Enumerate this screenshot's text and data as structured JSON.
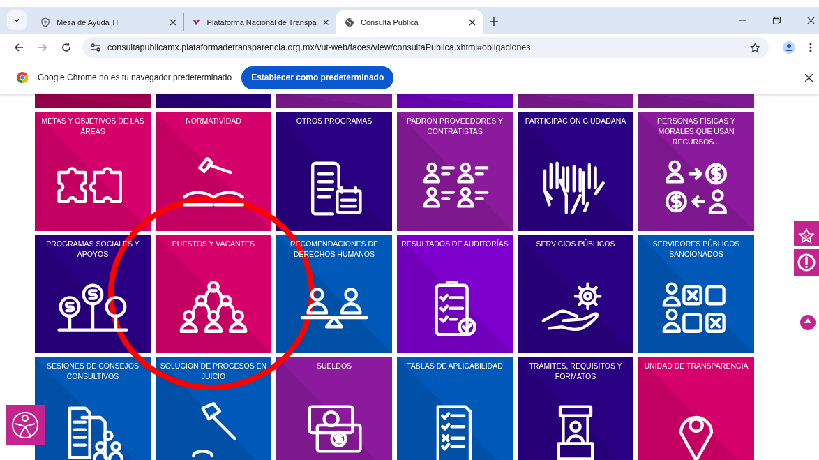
{
  "browser": {
    "tabs": [
      {
        "title": "Mesa de Ayuda TI",
        "selected": false
      },
      {
        "title": "Plataforma Nacional de Transpa",
        "selected": false
      },
      {
        "title": "Consulta Pública",
        "selected": true
      }
    ],
    "address": "consultapublicamx.plataformadetransparencia.org.mx/vut-web/faces/view/consultaPublica.xhtml#obligaciones"
  },
  "infobar": {
    "message": "Google Chrome no es tu navegador predeterminado",
    "button": "Establecer como predeterminado"
  },
  "tiles": [
    {
      "color": "#a0004f"
    },
    {
      "color": "#27007a"
    },
    {
      "color": "#801a94"
    },
    {
      "color": "#6e06bd"
    },
    {
      "color": "#801a94"
    },
    {
      "color": "#801a94"
    },
    {
      "label": "METAS Y OBJETIVOS DE LAS ÁREAS",
      "color": "#d6006b"
    },
    {
      "label": "NORMATIVIDAD",
      "color": "#d6006b"
    },
    {
      "label": "OTROS PROGRAMAS",
      "color": "#2a0082"
    },
    {
      "label": "PADRÓN PROVEEDORES Y CONTRATISTAS",
      "color": "#8b1a9c"
    },
    {
      "label": "PARTICIPACIÓN CIUDADANA",
      "color": "#2a0082"
    },
    {
      "label": "PERSONAS FÍSICAS Y MORALES QUE USAN RECURSOS...",
      "color": "#8b1a9c"
    },
    {
      "label": "PROGRAMAS SOCIALES Y APOYOS",
      "color": "#2a0082"
    },
    {
      "label": "PUESTOS Y VACANTES",
      "color": "#d6006b"
    },
    {
      "label": "RECOMENDACIONES DE DERECHOS HUMANOS",
      "color": "#0058b8"
    },
    {
      "label": "RESULTADOS DE AUDITORÍAS",
      "color": "#7d00cc"
    },
    {
      "label": "SERVICIOS PÚBLICOS",
      "color": "#2a0082"
    },
    {
      "label": "SERVIDORES PÚBLICOS SANCIONADOS",
      "color": "#0058b8"
    },
    {
      "label": "SESIONES DE CONSEJOS CONSULTIVOS",
      "color": "#0058b8"
    },
    {
      "label": "SOLUCIÓN DE PROCESOS EN JUICIO",
      "color": "#0058b8"
    },
    {
      "label": "SUELDOS",
      "color": "#8b1a9c"
    },
    {
      "label": "TABLAS DE APLICABILIDAD",
      "color": "#0058b8"
    },
    {
      "label": "TRÁMITES, REQUISITOS Y FORMATOS",
      "color": "#2a0082"
    },
    {
      "label": "UNIDAD DE TRANSPARENCIA",
      "color": "#d6006b"
    }
  ],
  "side_buttons": {
    "badge": "10"
  }
}
